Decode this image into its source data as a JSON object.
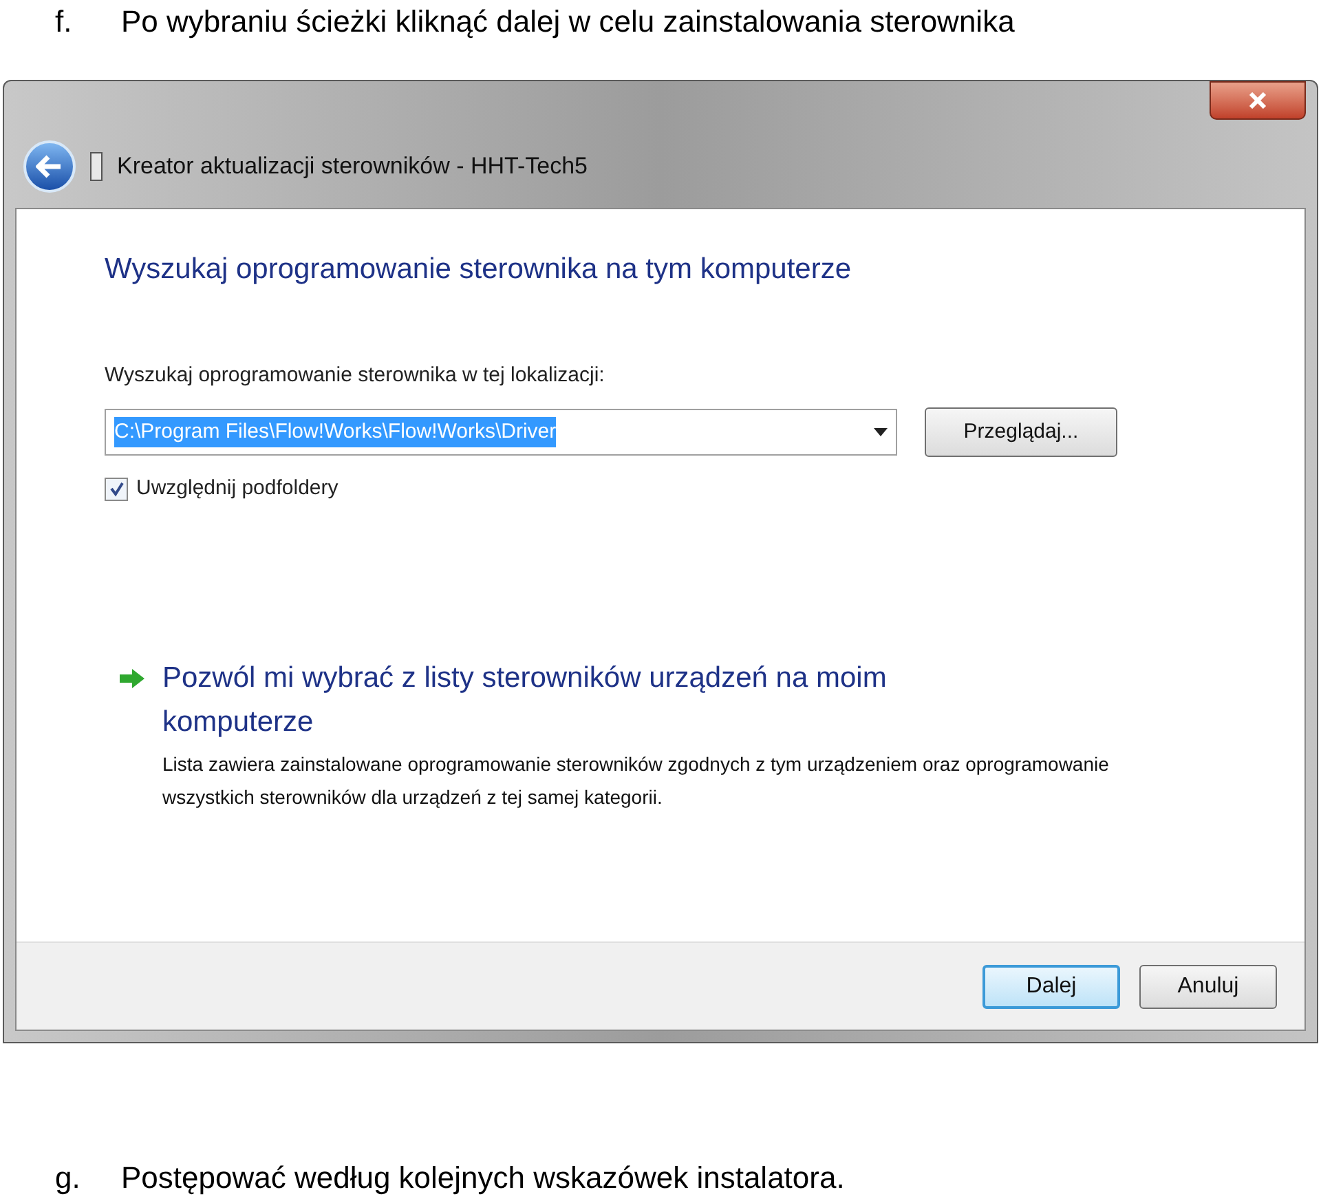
{
  "caption_top": {
    "marker": "f.",
    "text": "Po wybraniu ścieżki kliknąć dalej w celu zainstalowania sterownika"
  },
  "dialog": {
    "title": "Kreator aktualizacji sterowników - HHT-Tech5",
    "heading": "Wyszukaj oprogramowanie sterownika na tym komputerze",
    "location_label": "Wyszukaj oprogramowanie sterownika w tej lokalizacji:",
    "path_field": {
      "value": "C:\\Program Files\\Flow!Works\\Flow!Works\\Driver",
      "selected": true
    },
    "browse_button": "Przeglądaj...",
    "subfolders": {
      "label": "Uwzględnij podfoldery",
      "checked": true
    },
    "option": {
      "title": "Pozwól mi wybrać z listy sterowników urządzeń na moim komputerze",
      "description": "Lista zawiera zainstalowane oprogramowanie sterowników zgodnych z tym urządzeniem oraz oprogramowanie wszystkich sterowników dla urządzeń z tej samej kategorii."
    },
    "buttons": [
      {
        "label": "Dalej",
        "selected": true
      },
      {
        "label": "Anuluj",
        "selected": false
      }
    ]
  },
  "caption_bottom": {
    "marker": "g.",
    "text": "Postępować według kolejnych wskazówek instalatora."
  }
}
